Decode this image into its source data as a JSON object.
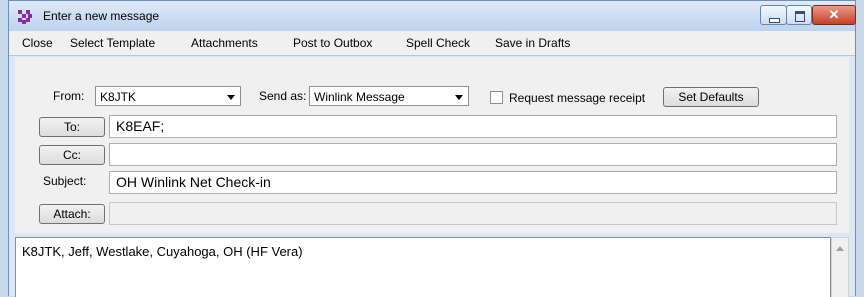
{
  "window": {
    "title": "Enter a new message"
  },
  "menu": [
    {
      "label": "Close"
    },
    {
      "label": "Select Template"
    },
    {
      "label": "Attachments"
    },
    {
      "label": "Post to Outbox"
    },
    {
      "label": "Spell Check"
    },
    {
      "label": "Save in Drafts"
    }
  ],
  "options": {
    "from_label": "From:",
    "from_value": "K8JTK",
    "send_as_label": "Send as:",
    "send_as_value": "Winlink Message",
    "receipt_label": "Request message receipt",
    "receipt_checked": false,
    "set_defaults_label": "Set Defaults"
  },
  "fields": {
    "to_button_label": "To:",
    "to_value": "K8EAF;",
    "cc_button_label": "Cc:",
    "cc_value": "",
    "subject_label": "Subject:",
    "subject_value": "OH Winlink Net Check-in",
    "attach_button_label": "Attach:",
    "attach_value": ""
  },
  "body": {
    "text": "K8JTK, Jeff, Westlake, Cuyahoga, OH (HF Vera)"
  },
  "colors": {
    "titlebar": "#bcd2ee",
    "close_button": "#c7402a",
    "panel": "#f0f0f0"
  }
}
